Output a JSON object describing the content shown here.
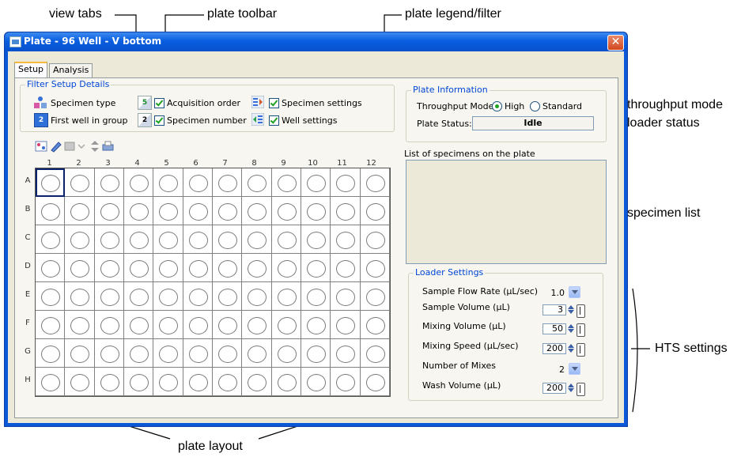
{
  "callouts": {
    "view_tabs": "view tabs",
    "plate_toolbar": "plate toolbar",
    "plate_legend_filter": "plate legend/filter",
    "throughput_mode": "throughput mode",
    "loader_status": "loader status",
    "specimen_list": "specimen list",
    "hts_settings": "HTS settings",
    "plate_layout": "plate layout"
  },
  "window": {
    "title": "Plate - 96 Well - V bottom",
    "close": "✕"
  },
  "tabs": [
    {
      "label": "Setup",
      "active": true
    },
    {
      "label": "Analysis",
      "active": false
    }
  ],
  "filter": {
    "title": "Filter Setup Details",
    "specimen_type": "Specimen type",
    "first_well": "First well in group",
    "first_well_badge": "2",
    "acquisition_order": "Acquisition order",
    "acquisition_badge": "5",
    "specimen_number": "Specimen number",
    "specimen_number_badge": "2",
    "specimen_settings": "Specimen settings",
    "well_settings": "Well settings"
  },
  "plate_info": {
    "title": "Plate Information",
    "throughput_label": "Throughput Mode",
    "high": "High",
    "standard": "Standard",
    "selected": "High",
    "status_label": "Plate Status:",
    "status_value": "Idle"
  },
  "specimen_list": {
    "title": "List of specimens on the plate"
  },
  "plate": {
    "columns": [
      "1",
      "2",
      "3",
      "4",
      "5",
      "6",
      "7",
      "8",
      "9",
      "10",
      "11",
      "12"
    ],
    "rows": [
      "A",
      "B",
      "C",
      "D",
      "E",
      "F",
      "G",
      "H"
    ],
    "selected_well": "A1"
  },
  "loader": {
    "title": "Loader Settings",
    "flow_rate_label": "Sample Flow Rate (µL/sec)",
    "flow_rate": "1.0",
    "sample_volume_label": "Sample Volume (µL)",
    "sample_volume": "3",
    "mixing_volume_label": "Mixing Volume (µL)",
    "mixing_volume": "50",
    "mixing_speed_label": "Mixing Speed (µL/sec)",
    "mixing_speed": "200",
    "num_mixes_label": "Number of Mixes",
    "num_mixes": "2",
    "wash_volume_label": "Wash Volume (µL)",
    "wash_volume": "200"
  }
}
